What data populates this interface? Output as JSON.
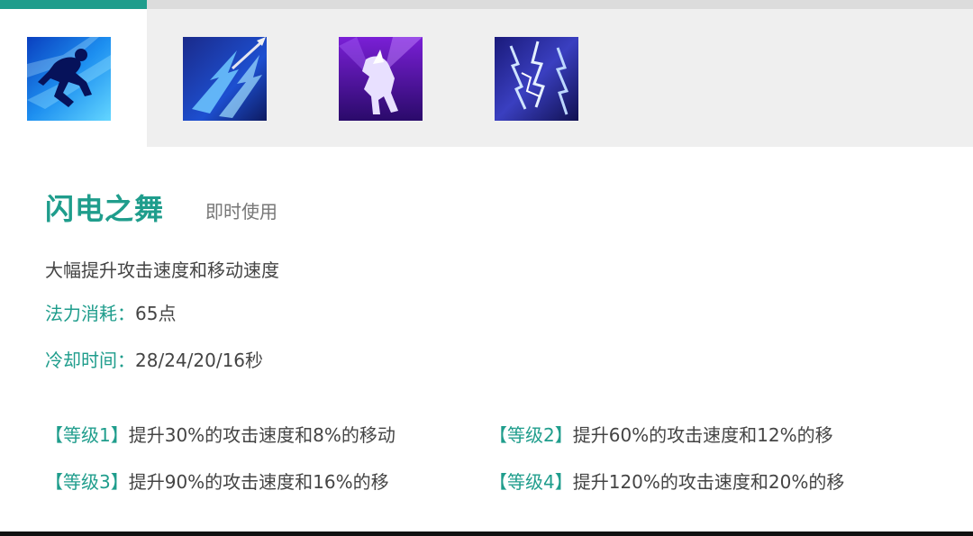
{
  "tabs": [
    {
      "icon": "sprint-figure-icon",
      "active": true
    },
    {
      "icon": "lightning-spear-icon",
      "active": false
    },
    {
      "icon": "lightning-horse-icon",
      "active": false
    },
    {
      "icon": "lightning-storm-icon",
      "active": false
    }
  ],
  "skill": {
    "name": "闪电之舞",
    "type": "即时使用",
    "description": "大幅提升攻击速度和移动速度",
    "mana_label": "法力消耗：",
    "mana_value": "65点",
    "cooldown_label": "冷却时间：",
    "cooldown_value": "28/24/20/16秒"
  },
  "levels": [
    {
      "tag": "【等级1】",
      "text": "提升30%的攻击速度和8%的移动"
    },
    {
      "tag": "【等级2】",
      "text": "提升60%的攻击速度和12%的移"
    },
    {
      "tag": "【等级3】",
      "text": "提升90%的攻击速度和16%的移"
    },
    {
      "tag": "【等级4】",
      "text": "提升120%的攻击速度和20%的移"
    }
  ],
  "colors": {
    "accent": "#1f9d8c",
    "tab_background": "#efefef"
  }
}
